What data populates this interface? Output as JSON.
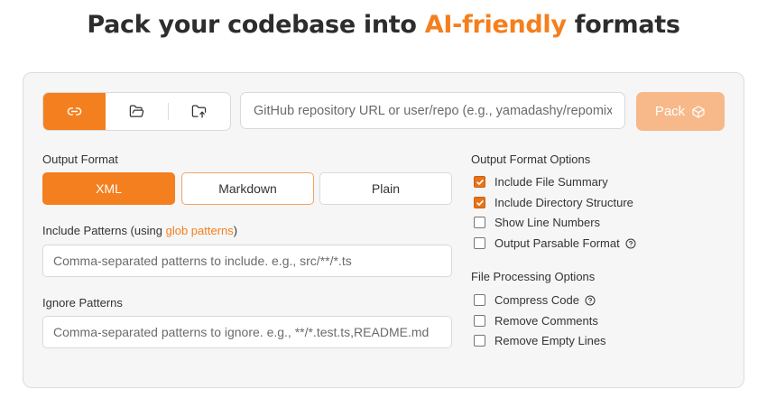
{
  "header": {
    "prefix": "Pack your codebase into",
    "accent": "AI-friendly",
    "suffix": "formats"
  },
  "modes": [
    {
      "icon": "link-icon",
      "active": true
    },
    {
      "icon": "folder-open-icon",
      "active": false
    },
    {
      "icon": "folder-upload-icon",
      "active": false
    }
  ],
  "url_input": {
    "placeholder": "GitHub repository URL or user/repo (e.g., yamadashy/repomix)",
    "value": ""
  },
  "pack_button": {
    "label": "Pack",
    "icon": "box-icon"
  },
  "output_format": {
    "label": "Output Format",
    "options": [
      "XML",
      "Markdown",
      "Plain"
    ],
    "selected": "XML"
  },
  "include_patterns": {
    "label_prefix": "Include Patterns (using",
    "label_link": "glob patterns",
    "label_suffix": ")",
    "placeholder": "Comma-separated patterns to include. e.g., src/**/*.ts",
    "value": ""
  },
  "ignore_patterns": {
    "label": "Ignore Patterns",
    "placeholder": "Comma-separated patterns to ignore. e.g., **/*.test.ts,README.md",
    "value": ""
  },
  "output_options": {
    "title": "Output Format Options",
    "items": [
      {
        "label": "Include File Summary",
        "checked": true
      },
      {
        "label": "Include Directory Structure",
        "checked": true
      },
      {
        "label": "Show Line Numbers",
        "checked": false
      },
      {
        "label": "Output Parsable Format",
        "checked": false,
        "help": true
      }
    ]
  },
  "processing_options": {
    "title": "File Processing Options",
    "items": [
      {
        "label": "Compress Code",
        "checked": false,
        "help": true
      },
      {
        "label": "Remove Comments",
        "checked": false
      },
      {
        "label": "Remove Empty Lines",
        "checked": false
      }
    ]
  },
  "colors": {
    "accent": "#f47f1e",
    "pack_disabled": "#f7b98a",
    "card_bg": "#f6f6f7"
  }
}
